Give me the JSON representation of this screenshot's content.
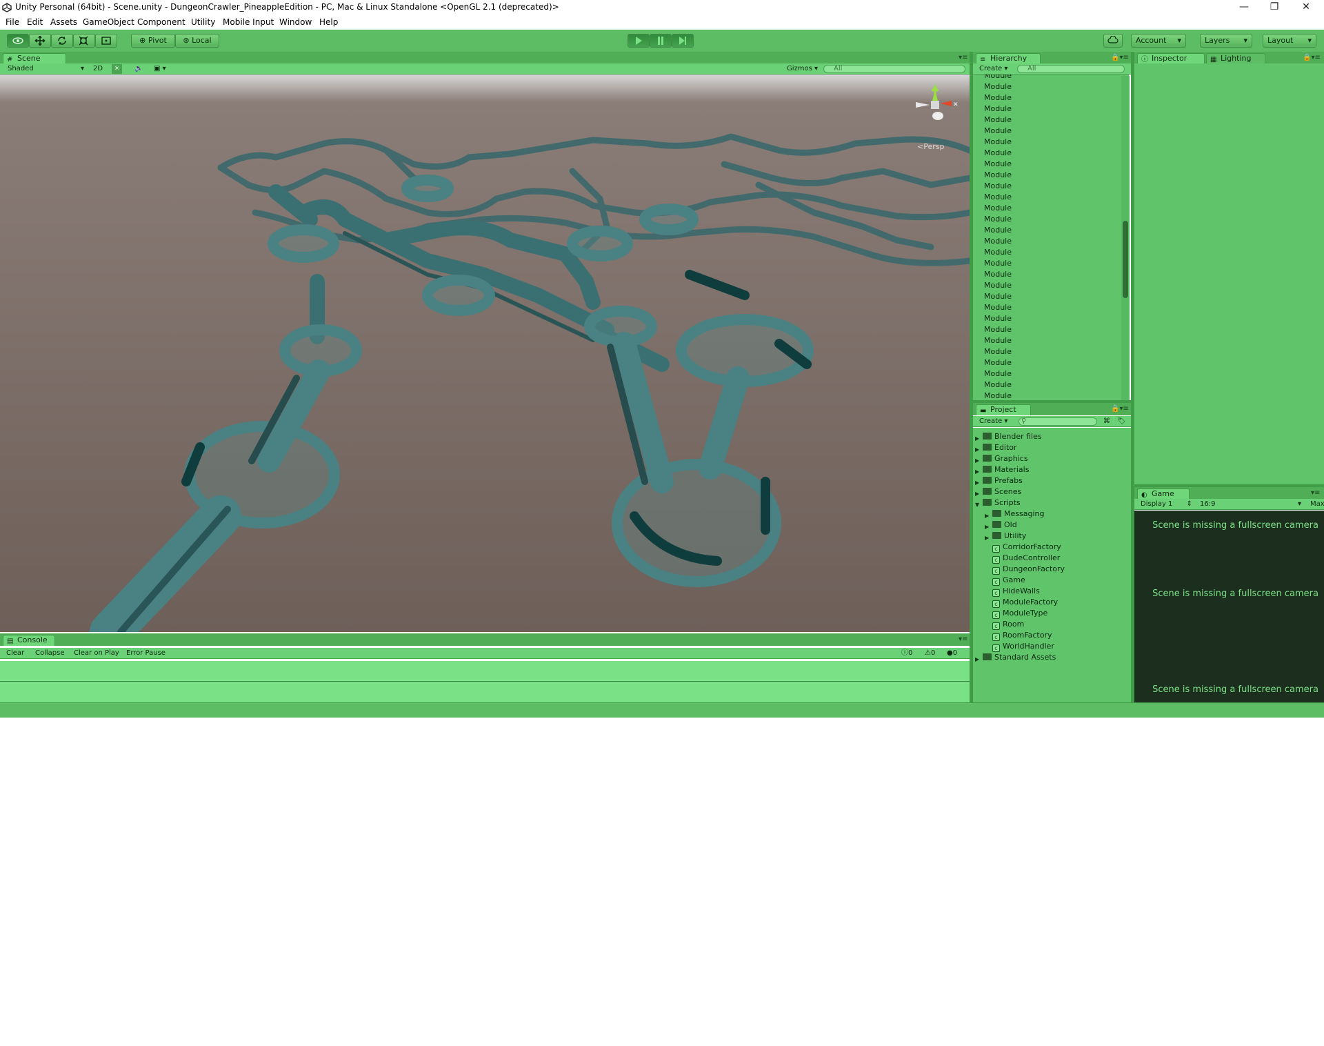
{
  "window": {
    "title": "Unity Personal (64bit) - Scene.unity - DungeonCrawler_PineappleEdition - PC, Mac & Linux Standalone <OpenGL 2.1 (deprecated)>",
    "minimize": "—",
    "restore": "❐",
    "close": "✕"
  },
  "menu": [
    "File",
    "Edit",
    "Assets",
    "GameObject",
    "Component",
    "Utility",
    "Mobile Input",
    "Window",
    "Help"
  ],
  "toolbar": {
    "pivot": "Pivot",
    "local": "Local",
    "account": "Account",
    "layers": "Layers",
    "layout": "Layout"
  },
  "scene": {
    "tab": "Scene",
    "shading": "Shaded",
    "mode2d": "2D",
    "gizmos": "Gizmos",
    "search_placeholder": "All",
    "persp": "Persp"
  },
  "console": {
    "tab": "Console",
    "clear": "Clear",
    "collapse": "Collapse",
    "clear_on_play": "Clear on Play",
    "error_pause": "Error Pause",
    "info_count": "0",
    "warning_count": "0",
    "error_count": "0"
  },
  "hierarchy": {
    "tab": "Hierarchy",
    "create": "Create",
    "search_placeholder": "All",
    "items": [
      "Module",
      "Module",
      "Module",
      "Module",
      "Module",
      "Module",
      "Module",
      "Module",
      "Module",
      "Module",
      "Module",
      "Module",
      "Module",
      "Module",
      "Module",
      "Module",
      "Module",
      "Module",
      "Module",
      "Module",
      "Module",
      "Module",
      "Module",
      "Module",
      "Module",
      "Module",
      "Module",
      "Module",
      "Module",
      "Module"
    ]
  },
  "project": {
    "tab": "Project",
    "create": "Create",
    "folders": [
      "Blender files",
      "Editor",
      "Graphics",
      "Materials",
      "Prefabs",
      "Scenes",
      "Scripts"
    ],
    "scripts_subfolders": [
      "Messaging",
      "Old",
      "Utility"
    ],
    "scripts_files": [
      "CorridorFactory",
      "DudeController",
      "DungeonFactory",
      "Game",
      "HideWalls",
      "ModuleFactory",
      "ModuleType",
      "Room",
      "RoomFactory",
      "WorldHandler"
    ],
    "last_folder": "Standard Assets"
  },
  "inspector": {
    "tab": "Inspector",
    "lighting_tab": "Lighting"
  },
  "game": {
    "tab": "Game",
    "display": "Display 1",
    "aspect": "16:9",
    "maximize": "Max",
    "messages": [
      "Scene is missing a fullscreen camera",
      "Scene is missing a fullscreen camera",
      "Scene is missing a fullscreen camera"
    ]
  },
  "colors": {
    "editor_green": "#5dbd64",
    "scene_floor": "#6e5f59",
    "walls": "#4f8c8e"
  }
}
